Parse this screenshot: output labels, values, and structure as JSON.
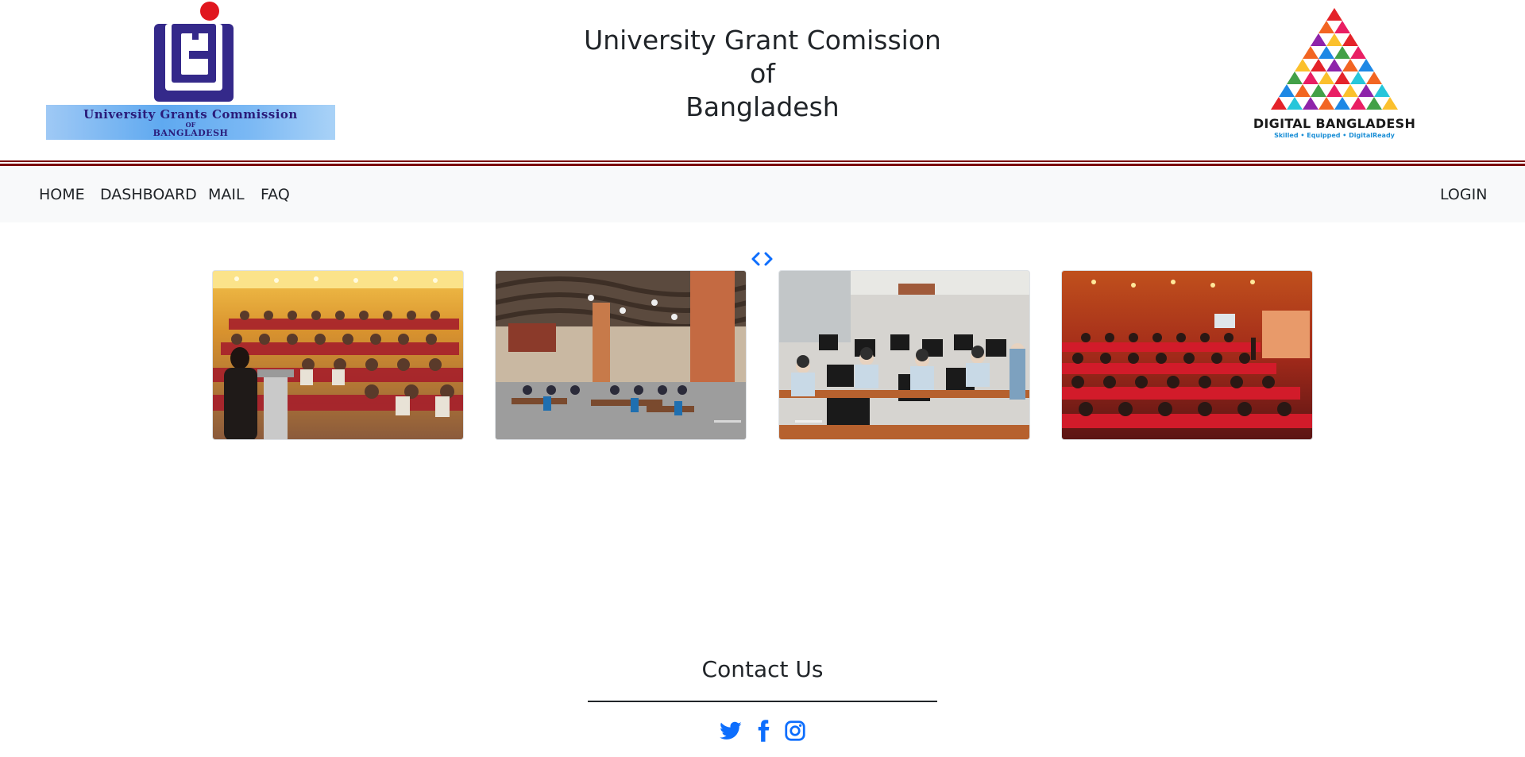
{
  "header": {
    "title_lines": [
      "University Grant Comission",
      "of",
      "Bangladesh"
    ],
    "left_logo": {
      "line1": "University Grants Commission",
      "line2": "OF",
      "line3": "BANGLADESH"
    },
    "right_logo": {
      "name": "DIGITAL BANGLADESH",
      "tagline": "Skilled • Equipped • DigitalReady"
    }
  },
  "nav": {
    "items": [
      {
        "label": "HOME"
      },
      {
        "label": "DASHBOARD"
      },
      {
        "label": "MAIL"
      },
      {
        "label": "FAQ"
      }
    ],
    "login": "LOGIN"
  },
  "carousel": {
    "prev_icon": "chevron-left-icon",
    "next_icon": "chevron-right-icon",
    "photos": [
      "seminar-audience-photo",
      "cafeteria-photo",
      "computer-lab-photo",
      "auditorium-photo"
    ]
  },
  "contact": {
    "heading": "Contact Us",
    "icons": [
      "twitter-icon",
      "facebook-icon",
      "instagram-icon"
    ]
  },
  "colors": {
    "accent_red": "#7a0a0a",
    "link_blue": "#0d6efd",
    "navbar_bg": "#f8f9fa"
  }
}
